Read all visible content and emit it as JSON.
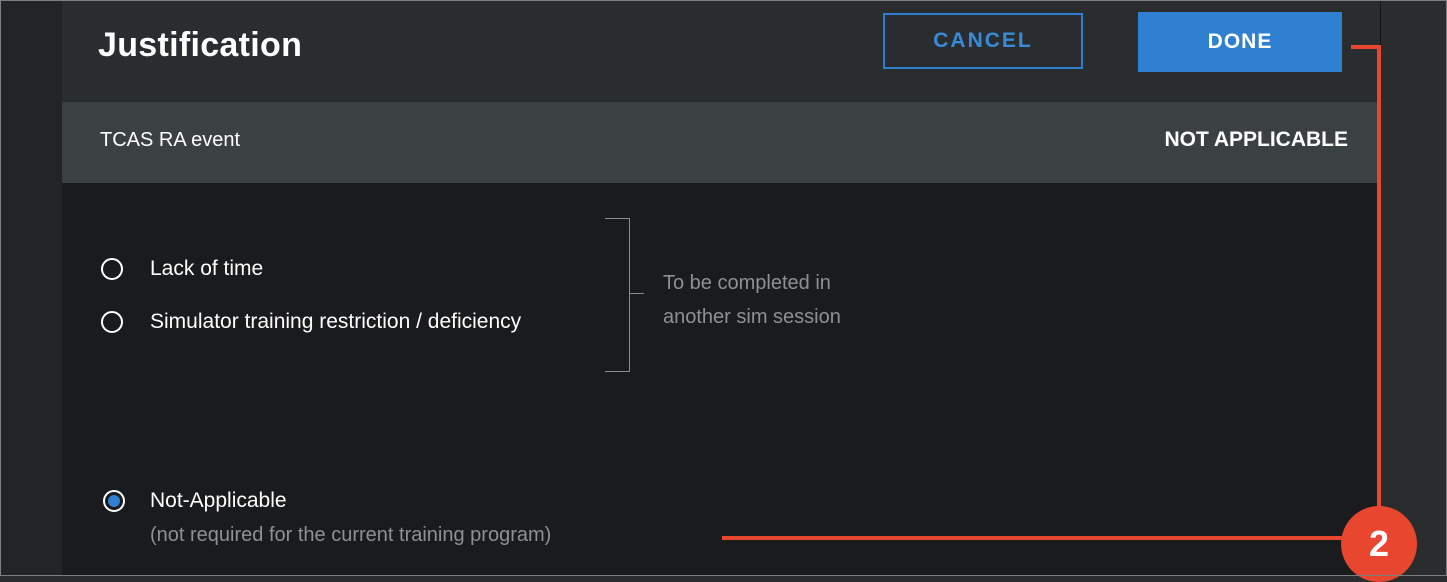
{
  "dialog": {
    "title": "Justification",
    "cancel_label": "CANCEL",
    "done_label": "DONE"
  },
  "event": {
    "name": "TCAS RA event",
    "status": "NOT APPLICABLE"
  },
  "options": [
    {
      "label": "Lack of time",
      "selected": false
    },
    {
      "label": "Simulator training restriction / deficiency",
      "selected": false
    },
    {
      "label": "Not-Applicable",
      "selected": true
    }
  ],
  "group_note": [
    "To be completed in",
    "another sim session"
  ],
  "not_applicable_note": "(not required for the current training program)",
  "annotation": {
    "number": "2",
    "color": "#e8462f"
  },
  "colors": {
    "accent": "#2f80d1",
    "background": "#1a1b1d"
  }
}
